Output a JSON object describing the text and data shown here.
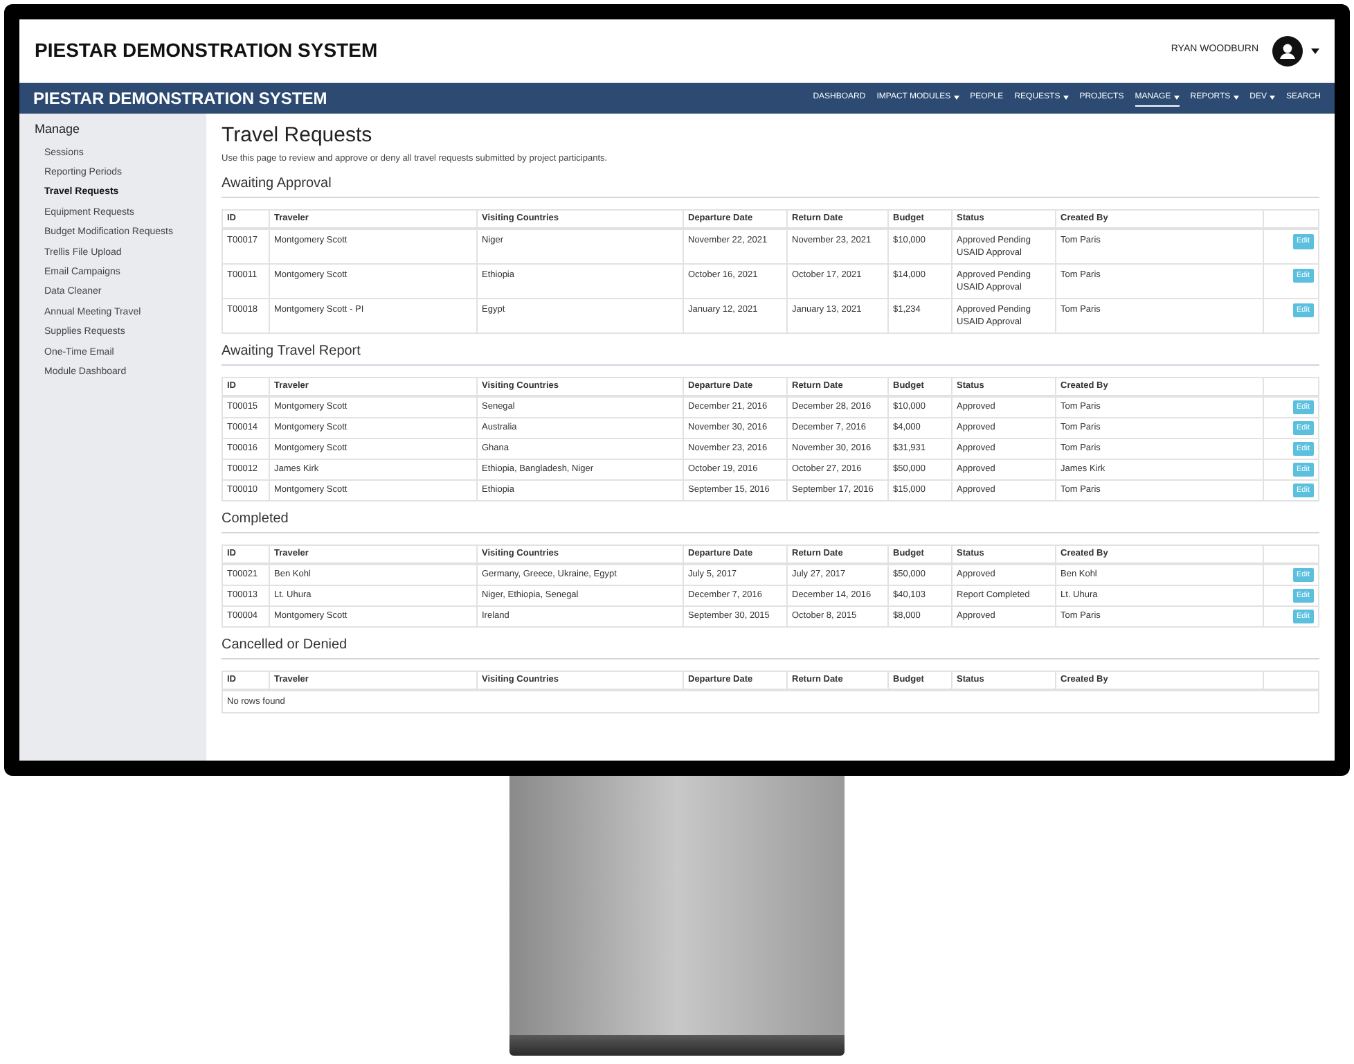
{
  "header": {
    "title": "PIESTAR DEMONSTRATION SYSTEM",
    "user_name": "RYAN WOODBURN"
  },
  "navbar": {
    "title": "PIESTAR DEMONSTRATION SYSTEM",
    "items": [
      {
        "label": "DASHBOARD",
        "has_menu": false,
        "selected": false
      },
      {
        "label": "IMPACT MODULES",
        "has_menu": true,
        "selected": false
      },
      {
        "label": "PEOPLE",
        "has_menu": false,
        "selected": false
      },
      {
        "label": "REQUESTS",
        "has_menu": true,
        "selected": false
      },
      {
        "label": "PROJECTS",
        "has_menu": false,
        "selected": false
      },
      {
        "label": "MANAGE",
        "has_menu": true,
        "selected": true
      },
      {
        "label": "REPORTS",
        "has_menu": true,
        "selected": false
      },
      {
        "label": "DEV",
        "has_menu": true,
        "selected": false
      },
      {
        "label": "SEARCH",
        "has_menu": false,
        "selected": false
      }
    ]
  },
  "sidebar": {
    "heading": "Manage",
    "items": [
      {
        "label": "Sessions",
        "selected": false
      },
      {
        "label": "Reporting Periods",
        "selected": false
      },
      {
        "label": "Travel Requests",
        "selected": true
      },
      {
        "label": "Equipment Requests",
        "selected": false
      },
      {
        "label": "Budget Modification Requests",
        "selected": false
      },
      {
        "label": "Trellis File Upload",
        "selected": false
      },
      {
        "label": "Email Campaigns",
        "selected": false
      },
      {
        "label": "Data Cleaner",
        "selected": false
      },
      {
        "label": "Annual Meeting Travel",
        "selected": false
      },
      {
        "label": "Supplies Requests",
        "selected": false
      },
      {
        "label": "One-Time Email",
        "selected": false
      },
      {
        "label": "Module Dashboard",
        "selected": false
      }
    ]
  },
  "page": {
    "title": "Travel Requests",
    "description": "Use this page to review and approve or deny all travel requests submitted by project participants."
  },
  "sections": [
    {
      "title": "Awaiting Approval",
      "columns": [
        "ID",
        "Traveler",
        "Visiting Countries",
        "Departure Date",
        "Return Date",
        "Budget",
        "Status",
        "Created By"
      ],
      "rows": [
        {
          "cells": [
            "T00017",
            "Montgomery Scott",
            "Niger",
            "November 22, 2021",
            "November 23, 2021",
            "$10,000",
            "Approved Pending USAID Approval",
            "Tom Paris"
          ],
          "action": "Edit"
        },
        {
          "cells": [
            "T00011",
            "Montgomery Scott",
            "Ethiopia",
            "October 16, 2021",
            "October 17, 2021",
            "$14,000",
            "Approved Pending USAID Approval",
            "Tom Paris"
          ],
          "action": "Edit"
        },
        {
          "cells": [
            "T00018",
            "Montgomery Scott - PI",
            "Egypt",
            "January 12, 2021",
            "January 13, 2021",
            "$1,234",
            "Approved Pending USAID Approval",
            "Tom Paris"
          ],
          "action": "Edit"
        }
      ]
    },
    {
      "title": "Awaiting Travel Report",
      "columns": [
        "ID",
        "Traveler",
        "Visiting Countries",
        "Departure Date",
        "Return Date",
        "Budget",
        "Status",
        "Created By"
      ],
      "rows": [
        {
          "cells": [
            "T00015",
            "Montgomery Scott",
            "Senegal",
            "December 21, 2016",
            "December 28, 2016",
            "$10,000",
            "Approved",
            "Tom Paris"
          ],
          "action": "Edit"
        },
        {
          "cells": [
            "T00014",
            "Montgomery Scott",
            "Australia",
            "November 30, 2016",
            "December 7, 2016",
            "$4,000",
            "Approved",
            "Tom Paris"
          ],
          "action": "Edit"
        },
        {
          "cells": [
            "T00016",
            "Montgomery Scott",
            "Ghana",
            "November 23, 2016",
            "November 30, 2016",
            "$31,931",
            "Approved",
            "Tom Paris"
          ],
          "action": "Edit"
        },
        {
          "cells": [
            "T00012",
            "James Kirk",
            "Ethiopia, Bangladesh, Niger",
            "October 19, 2016",
            "October 27, 2016",
            "$50,000",
            "Approved",
            "James Kirk"
          ],
          "action": "Edit"
        },
        {
          "cells": [
            "T00010",
            "Montgomery Scott",
            "Ethiopia",
            "September 15, 2016",
            "September 17, 2016",
            "$15,000",
            "Approved",
            "Tom Paris"
          ],
          "action": "Edit"
        }
      ]
    },
    {
      "title": "Completed",
      "columns": [
        "ID",
        "Traveler",
        "Visiting Countries",
        "Departure Date",
        "Return Date",
        "Budget",
        "Status",
        "Created By"
      ],
      "rows": [
        {
          "cells": [
            "T00021",
            "Ben Kohl",
            "Germany, Greece, Ukraine, Egypt",
            "July 5, 2017",
            "July 27, 2017",
            "$50,000",
            "Approved",
            "Ben Kohl"
          ],
          "action": "Edit"
        },
        {
          "cells": [
            "T00013",
            "Lt. Uhura",
            "Niger, Ethiopia, Senegal",
            "December 7, 2016",
            "December 14, 2016",
            "$40,103",
            "Report Completed",
            "Lt. Uhura"
          ],
          "action": "Edit"
        },
        {
          "cells": [
            "T00004",
            "Montgomery Scott",
            "Ireland",
            "September 30, 2015",
            "October 8, 2015",
            "$8,000",
            "Approved",
            "Tom Paris"
          ],
          "action": "Edit"
        }
      ]
    },
    {
      "title": "Cancelled or Denied",
      "columns": [
        "ID",
        "Traveler",
        "Visiting Countries",
        "Departure Date",
        "Return Date",
        "Budget",
        "Status",
        "Created By"
      ],
      "empty_message": "No rows found"
    }
  ]
}
